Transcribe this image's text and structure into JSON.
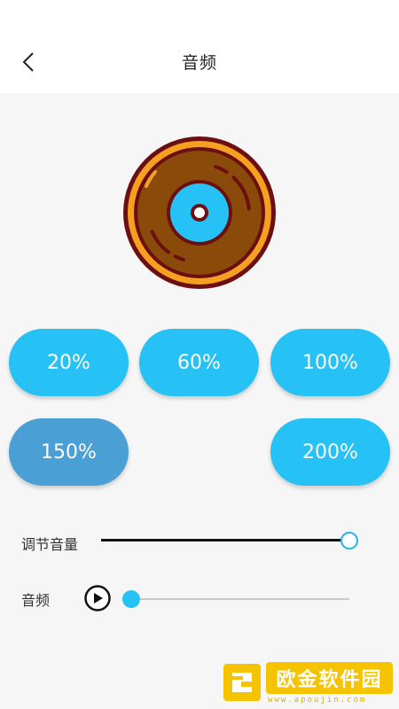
{
  "header": {
    "title": "音频"
  },
  "rates": [
    {
      "label": "20%",
      "selected": false
    },
    {
      "label": "60%",
      "selected": false
    },
    {
      "label": "100%",
      "selected": false
    },
    {
      "label": "150%",
      "selected": true
    },
    {
      "label": "200%",
      "selected": false
    }
  ],
  "volume": {
    "label": "调节音量",
    "level": 1.0
  },
  "audio": {
    "label": "音频",
    "progress": 0.0
  },
  "watermark": {
    "name": "欧金软件园",
    "url": "www.apoujin.com"
  },
  "colors": {
    "accent": "#27c2f5",
    "selected": "#4a9fd4",
    "record_body": "#8a4b0a",
    "record_ring": "#f5a020",
    "record_outline": "#6b0f12"
  }
}
